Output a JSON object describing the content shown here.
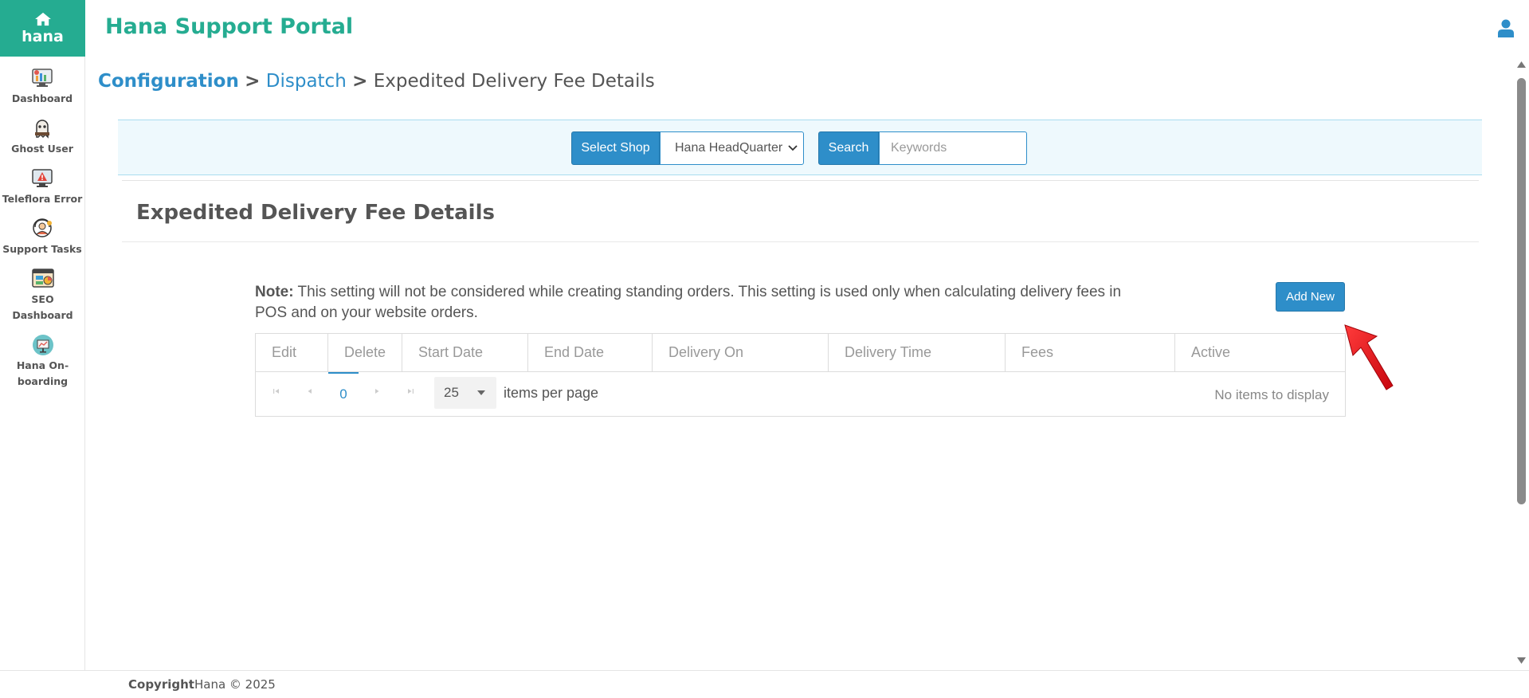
{
  "sidebar": {
    "brand": "hana",
    "items": [
      {
        "label": "Dashboard",
        "icon": "dashboard-icon"
      },
      {
        "label": "Ghost User",
        "icon": "ghost-user-icon"
      },
      {
        "label": "Teleflora Error",
        "icon": "teleflora-error-icon"
      },
      {
        "label": "Support Tasks",
        "icon": "support-tasks-icon"
      },
      {
        "label": "SEO Dashboard",
        "icon": "seo-dashboard-icon"
      },
      {
        "label": "Hana On-boarding",
        "icon": "onboarding-icon"
      }
    ]
  },
  "header": {
    "title": "Hana Support Portal",
    "user_icon": "user-icon"
  },
  "breadcrumb": {
    "root": "Configuration",
    "sep1": ">",
    "parent": "Dispatch",
    "sep2": ">",
    "current": "Expedited Delivery Fee Details"
  },
  "filter": {
    "select_shop_label": "Select Shop",
    "shop_value": "Hana HeadQuarter",
    "search_label": "Search",
    "search_placeholder": "Keywords"
  },
  "section": {
    "title": "Expedited Delivery Fee Details",
    "note_prefix": "Note:",
    "note_text": " This setting will not be considered while creating standing orders. This setting is used only when calculating delivery fees in POS and on your website orders.",
    "add_new_label": "Add New"
  },
  "grid": {
    "columns": [
      "Edit",
      "Delete",
      "Start Date",
      "End Date",
      "Delivery On",
      "Delivery Time",
      "Fees",
      "Active"
    ],
    "rows": [],
    "pager": {
      "current_page": "0",
      "page_size": "25",
      "page_size_label": "items per page",
      "empty_text": "No items to display"
    }
  },
  "footer": {
    "copyright_label": "Copyright",
    "copyright_text": "Hana © 2025"
  },
  "colors": {
    "brand_green": "#25ac91",
    "accent_blue": "#2e8ec9",
    "filter_bg": "#eef9fd",
    "annotation_red": "#e8141c"
  }
}
